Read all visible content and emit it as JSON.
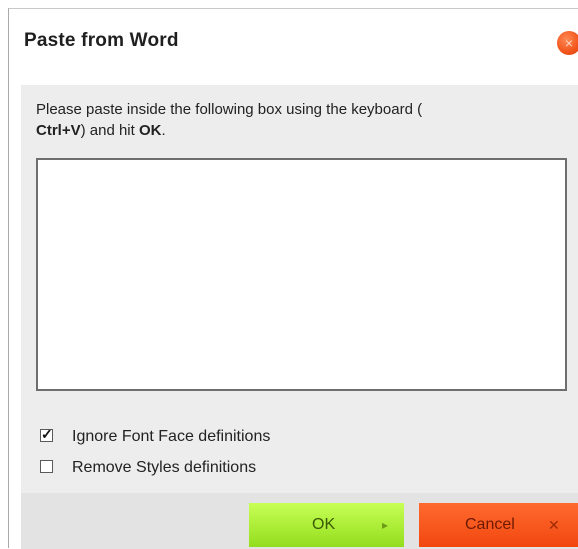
{
  "dialog": {
    "title": "Paste from Word",
    "close_glyph": "×"
  },
  "instructions": {
    "text_before": "Please paste inside the following box using the keyboard (",
    "shortcut": "Ctrl+V",
    "text_middle": ") and hit",
    "confirm_word": "OK",
    "text_after": "."
  },
  "paste_area": {
    "value": ""
  },
  "options": [
    {
      "label": "Ignore Font Face definitions",
      "checked": true
    },
    {
      "label": "Remove Styles definitions",
      "checked": false
    }
  ],
  "buttons": {
    "ok_label": "OK",
    "ok_icon": "▸",
    "cancel_label": "Cancel",
    "cancel_icon": "✕"
  },
  "colors": {
    "ok_accent": "#93dd1d",
    "cancel_accent": "#f1470f",
    "close_accent": "#f2541b"
  },
  "icons": {
    "close": "close-icon",
    "ok": "arrow-right-icon",
    "cancel": "x-icon",
    "check": "checkmark-icon"
  }
}
